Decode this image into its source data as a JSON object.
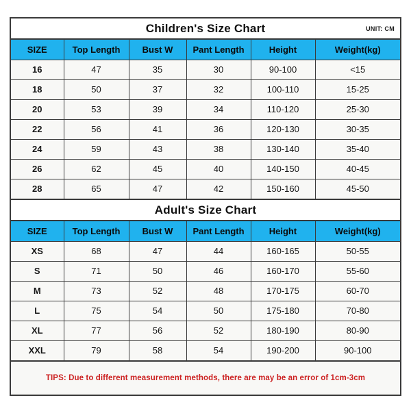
{
  "document": {
    "unit_label": "UNIT: CM",
    "accent_blue": "#20B2EE",
    "border_color": "#3a3a3a",
    "cell_background": "#f8f8f6",
    "tips_color": "#cc2222"
  },
  "children_section": {
    "title": "Children's Size Chart",
    "columns": [
      "SIZE",
      "Top Length",
      "Bust W",
      "Pant Length",
      "Height",
      "Weight(kg)"
    ],
    "rows": [
      {
        "size": "16",
        "top_length": "47",
        "bust_w": "35",
        "pant_length": "30",
        "height": "90-100",
        "weight": "<15"
      },
      {
        "size": "18",
        "top_length": "50",
        "bust_w": "37",
        "pant_length": "32",
        "height": "100-110",
        "weight": "15-25"
      },
      {
        "size": "20",
        "top_length": "53",
        "bust_w": "39",
        "pant_length": "34",
        "height": "110-120",
        "weight": "25-30"
      },
      {
        "size": "22",
        "top_length": "56",
        "bust_w": "41",
        "pant_length": "36",
        "height": "120-130",
        "weight": "30-35"
      },
      {
        "size": "24",
        "top_length": "59",
        "bust_w": "43",
        "pant_length": "38",
        "height": "130-140",
        "weight": "35-40"
      },
      {
        "size": "26",
        "top_length": "62",
        "bust_w": "45",
        "pant_length": "40",
        "height": "140-150",
        "weight": "40-45"
      },
      {
        "size": "28",
        "top_length": "65",
        "bust_w": "47",
        "pant_length": "42",
        "height": "150-160",
        "weight": "45-50"
      }
    ]
  },
  "adult_section": {
    "title": "Adult's Size Chart",
    "columns": [
      "SIZE",
      "Top Length",
      "Bust W",
      "Pant Length",
      "Height",
      "Weight(kg)"
    ],
    "rows": [
      {
        "size": "XS",
        "top_length": "68",
        "bust_w": "47",
        "pant_length": "44",
        "height": "160-165",
        "weight": "50-55"
      },
      {
        "size": "S",
        "top_length": "71",
        "bust_w": "50",
        "pant_length": "46",
        "height": "160-170",
        "weight": "55-60"
      },
      {
        "size": "M",
        "top_length": "73",
        "bust_w": "52",
        "pant_length": "48",
        "height": "170-175",
        "weight": "60-70"
      },
      {
        "size": "L",
        "top_length": "75",
        "bust_w": "54",
        "pant_length": "50",
        "height": "175-180",
        "weight": "70-80"
      },
      {
        "size": "XL",
        "top_length": "77",
        "bust_w": "56",
        "pant_length": "52",
        "height": "180-190",
        "weight": "80-90"
      },
      {
        "size": "XXL",
        "top_length": "79",
        "bust_w": "58",
        "pant_length": "54",
        "height": "190-200",
        "weight": "90-100"
      }
    ]
  },
  "footer": {
    "tips": "TIPS: Due to different measurement methods, there are may be an error of 1cm-3cm"
  }
}
